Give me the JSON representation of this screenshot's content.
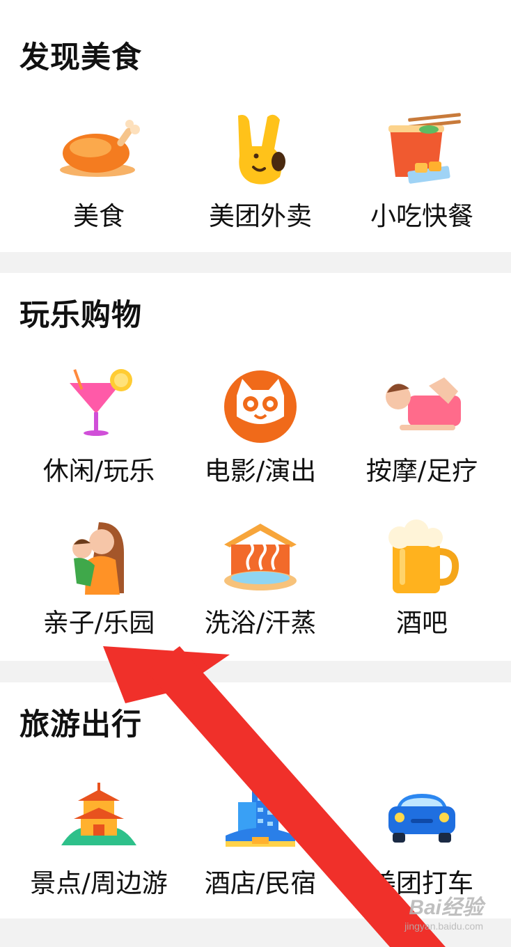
{
  "sections": [
    {
      "title": "发现美食",
      "items": [
        {
          "label": "美食",
          "icon": "roast-chicken-icon"
        },
        {
          "label": "美团外卖",
          "icon": "kangaroo-mascot-icon"
        },
        {
          "label": "小吃快餐",
          "icon": "noodle-bowl-icon"
        }
      ]
    },
    {
      "title": "玩乐购物",
      "items": [
        {
          "label": "休闲/玩乐",
          "icon": "cocktail-icon"
        },
        {
          "label": "电影/演出",
          "icon": "cat-movie-icon"
        },
        {
          "label": "按摩/足疗",
          "icon": "massage-icon"
        },
        {
          "label": "亲子/乐园",
          "icon": "parent-child-icon"
        },
        {
          "label": "洗浴/汗蒸",
          "icon": "hot-spring-icon"
        },
        {
          "label": "酒吧",
          "icon": "beer-mug-icon"
        }
      ]
    },
    {
      "title": "旅游出行",
      "items": [
        {
          "label": "景点/周边游",
          "icon": "pagoda-icon"
        },
        {
          "label": "酒店/民宿",
          "icon": "hotel-building-icon"
        },
        {
          "label": "美团打车",
          "icon": "car-icon"
        }
      ]
    }
  ],
  "watermark": {
    "brand": "Bai经验",
    "url": "jingyan.baidu.com"
  },
  "colors": {
    "arrow": "#f0302a",
    "section_bg": "#ffffff",
    "page_bg": "#f2f2f2"
  }
}
